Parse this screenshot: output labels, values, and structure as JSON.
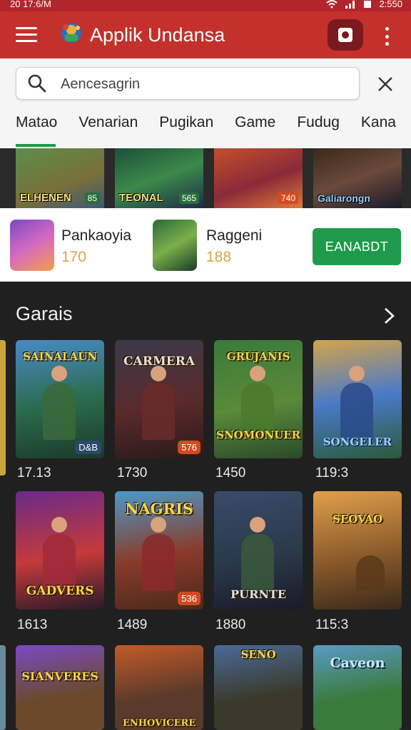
{
  "status": {
    "time": "20 17:6/M",
    "clock": "2:550"
  },
  "appbar": {
    "title": "Applik Undansa",
    "menu_icon": "hamburger-menu-icon",
    "record_icon": "record-icon",
    "more_icon": "more-vert-icon"
  },
  "search": {
    "placeholder": "Aencesagrin",
    "value": "",
    "icon": "search-icon",
    "clear_icon": "close-icon"
  },
  "tabs": [
    "Matao",
    "Venarian",
    "Pugikan",
    "Game",
    "Fudug",
    "Kana"
  ],
  "banners": [
    {
      "label": "ELHENEN",
      "num": "85"
    },
    {
      "label": "TEONAL",
      "num": "565"
    },
    {
      "label": "",
      "num": "740"
    },
    {
      "label": "Galiarongn",
      "num": ""
    }
  ],
  "install_row": {
    "items": [
      {
        "name": "Pankaoyia",
        "count": "170"
      },
      {
        "name": "Raggeni",
        "count": "188"
      }
    ],
    "button": "EANABDT"
  },
  "section": {
    "title": "Garais",
    "chevron": "chevron-right-icon"
  },
  "games": [
    {
      "title": "SAINALAUN",
      "badge": "D&B",
      "count": "17.13"
    },
    {
      "title": "CARMERA",
      "badge": "576",
      "count": "1730"
    },
    {
      "title": "SNOMONUER",
      "badge": "",
      "count": "1450"
    },
    {
      "title": "SONGELER",
      "badge": "",
      "count": "119:3"
    },
    {
      "title": "GADVERS",
      "badge": "",
      "count": "1613"
    },
    {
      "title": "NAGRIS",
      "badge": "536",
      "count": "1489"
    },
    {
      "title": "PURNTE",
      "badge": "",
      "count": "1880"
    },
    {
      "title": "SEOVAO",
      "badge": "",
      "count": "115:3"
    },
    {
      "title": "SIANVERES",
      "badge": "",
      "count": ""
    },
    {
      "title": "ENHOVICERE",
      "badge": "",
      "count": ""
    },
    {
      "title": "SENO",
      "badge": "",
      "count": ""
    },
    {
      "title": "Caveon",
      "badge": "",
      "count": ""
    }
  ],
  "colors": {
    "appbar": "#c4302b",
    "accent_green": "#1e9b4a",
    "count_gold": "#d8a34a",
    "background_dark": "#202020"
  }
}
